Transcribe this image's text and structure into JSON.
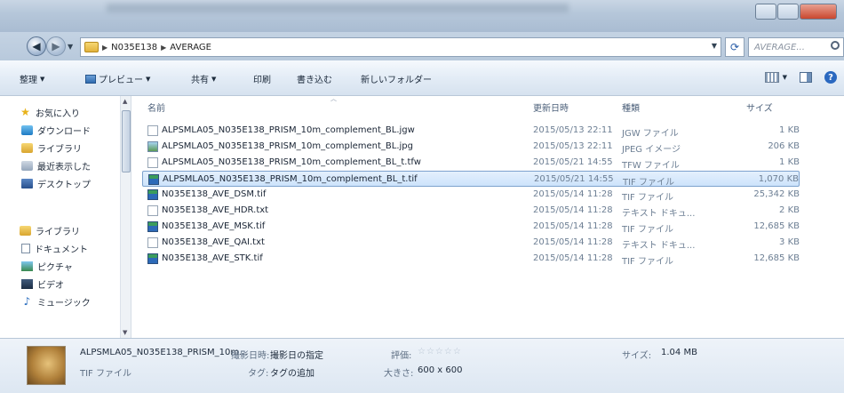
{
  "window": {
    "address": {
      "crumbs": [
        "N035E138",
        "AVERAGE"
      ],
      "search_placeholder": "AVERAGE..."
    }
  },
  "toolbar": {
    "organize": "整理",
    "preview": "プレビュー",
    "share": "共有",
    "print": "印刷",
    "burn": "書き込む",
    "new_folder": "新しいフォルダー"
  },
  "nav": {
    "items": [
      {
        "label": "お気に入り",
        "icon": "star-icon"
      },
      {
        "label": "ダウンロード",
        "icon": "download-icon"
      },
      {
        "label": "ライブラリ",
        "icon": "library-icon"
      },
      {
        "label": "最近表示した",
        "icon": "recent-places-icon"
      },
      {
        "label": "デスクトップ",
        "icon": "desktop-icon"
      },
      {
        "label": "ライブラリ",
        "icon": "library-icon"
      },
      {
        "label": "ドキュメント",
        "icon": "documents-icon"
      },
      {
        "label": "ピクチャ",
        "icon": "pictures-icon"
      },
      {
        "label": "ビデオ",
        "icon": "videos-icon"
      },
      {
        "label": "ミュージック",
        "icon": "music-icon"
      }
    ]
  },
  "columns": {
    "name": "名前",
    "date": "更新日時",
    "type": "種類",
    "size": "サイズ"
  },
  "files": [
    {
      "name": "ALPSMLA05_N035E138_PRISM_10m_complement_BL.jgw",
      "date": "2015/05/13 22:11",
      "type": "JGW ファイル",
      "size": "1 KB",
      "icon": "text-file-icon"
    },
    {
      "name": "ALPSMLA05_N035E138_PRISM_10m_complement_BL.jpg",
      "date": "2015/05/13 22:11",
      "type": "JPEG イメージ",
      "size": "206 KB",
      "icon": "jpeg-file-icon"
    },
    {
      "name": "ALPSMLA05_N035E138_PRISM_10m_complement_BL_t.tfw",
      "date": "2015/05/21 14:55",
      "type": "TFW ファイル",
      "size": "1 KB",
      "icon": "text-file-icon"
    },
    {
      "name": "ALPSMLA05_N035E138_PRISM_10m_complement_BL_t.tif",
      "date": "2015/05/21 14:55",
      "type": "TIF ファイル",
      "size": "1,070 KB",
      "icon": "tif-file-icon",
      "selected": true
    },
    {
      "name": "N035E138_AVE_DSM.tif",
      "date": "2015/05/14 11:28",
      "type": "TIF ファイル",
      "size": "25,342 KB",
      "icon": "tif-file-icon"
    },
    {
      "name": "N035E138_AVE_HDR.txt",
      "date": "2015/05/14 11:28",
      "type": "テキスト ドキュ...",
      "size": "2 KB",
      "icon": "text-file-icon"
    },
    {
      "name": "N035E138_AVE_MSK.tif",
      "date": "2015/05/14 11:28",
      "type": "TIF ファイル",
      "size": "12,685 KB",
      "icon": "tif-file-icon"
    },
    {
      "name": "N035E138_AVE_QAI.txt",
      "date": "2015/05/14 11:28",
      "type": "テキスト ドキュ...",
      "size": "3 KB",
      "icon": "text-file-icon"
    },
    {
      "name": "N035E138_AVE_STK.tif",
      "date": "2015/05/14 11:28",
      "type": "TIF ファイル",
      "size": "12,685 KB",
      "icon": "tif-file-icon"
    }
  ],
  "details": {
    "filename": "ALPSMLA05_N035E138_PRISM_10m...",
    "filetype": "TIF ファイル",
    "date_taken_label": "撮影日時:",
    "date_taken_value": "撮影日の指定",
    "tags_label": "タグ:",
    "tags_value": "タグの追加",
    "rating_label": "評価:",
    "rating_value": "☆☆☆☆☆",
    "dimensions_label": "大きさ:",
    "dimensions_value": "600 x 600",
    "size_label": "サイズ:",
    "size_value": "1.04 MB"
  }
}
